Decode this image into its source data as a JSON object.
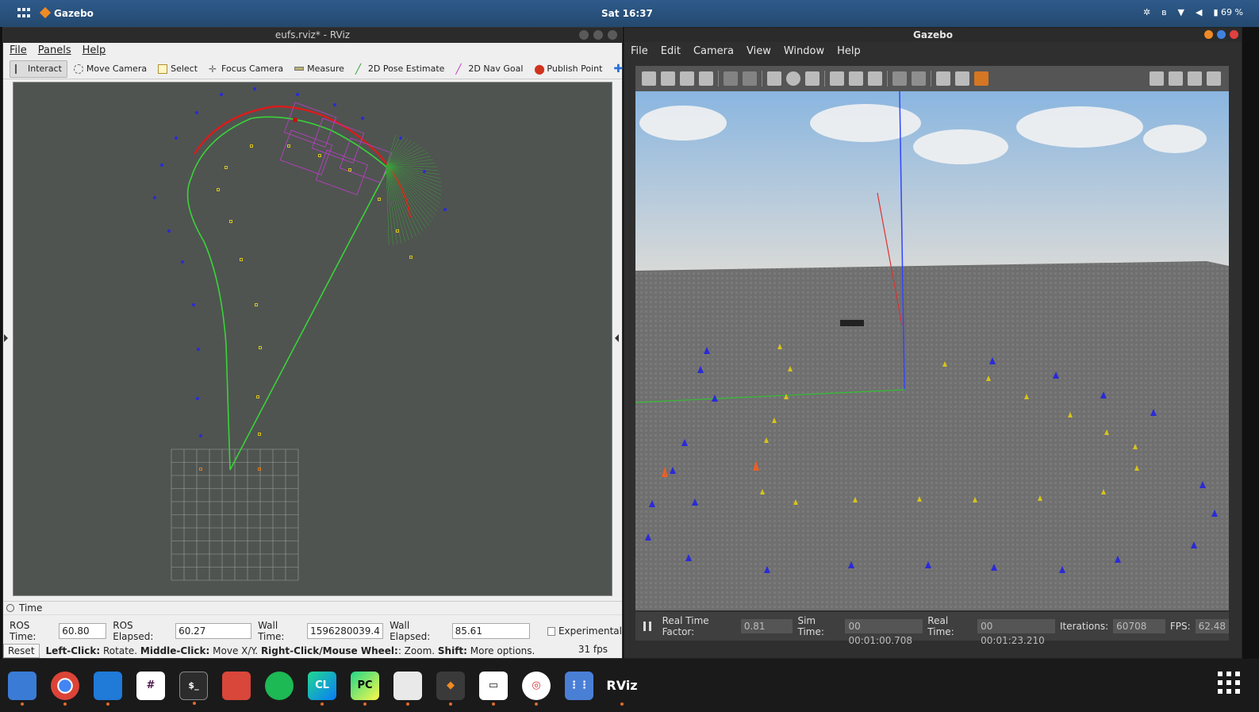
{
  "topbar": {
    "app_name": "Gazebo",
    "clock": "Sat 16:37",
    "battery": "69 %"
  },
  "rviz": {
    "title": "eufs.rviz* - RViz",
    "menu": [
      "File",
      "Panels",
      "Help"
    ],
    "tools": [
      "Interact",
      "Move Camera",
      "Select",
      "Focus Camera",
      "Measure",
      "2D Pose Estimate",
      "2D Nav Goal",
      "Publish Point"
    ],
    "time_panel": {
      "title": "Time",
      "ros_time_label": "ROS Time:",
      "ros_time": "60.80",
      "ros_elapsed_label": "ROS Elapsed:",
      "ros_elapsed": "60.27",
      "wall_time_label": "Wall Time:",
      "wall_time": "1596280039.40",
      "wall_elapsed_label": "Wall Elapsed:",
      "wall_elapsed": "85.61",
      "experimental_label": "Experimental"
    },
    "reset_label": "Reset",
    "help_text": {
      "left_click_key": "Left-Click:",
      "left_click": " Rotate. ",
      "middle_click_key": "Middle-Click:",
      "middle_click": " Move X/Y. ",
      "right_click_key": "Right-Click/Mouse Wheel:",
      "right_click": ": Zoom. ",
      "shift_key": "Shift:",
      "shift": " More options."
    },
    "fps": "31 fps"
  },
  "gazebo": {
    "title": "Gazebo",
    "menu": [
      "File",
      "Edit",
      "Camera",
      "View",
      "Window",
      "Help"
    ],
    "status": {
      "real_time_factor_label": "Real Time Factor:",
      "real_time_factor": "0.81",
      "sim_time_label": "Sim Time:",
      "sim_time": "00 00:01:00.708",
      "real_time_label": "Real Time:",
      "real_time": "00 00:01:23.210",
      "iterations_label": "Iterations:",
      "iterations": "60708",
      "fps_label": "FPS:",
      "fps": "62.48"
    }
  },
  "dock": {
    "items": [
      "files-icon",
      "chrome-icon",
      "vscode-icon",
      "slack-icon",
      "terminal-icon",
      "toolbox-icon",
      "spotify-icon",
      "clion-icon",
      "pycharm-icon",
      "software-icon",
      "gazebo-icon",
      "monitor-icon",
      "help-icon",
      "apps-icon"
    ],
    "rviz_label": "RViz"
  },
  "colors": {
    "blue_cone": "#2a2ad8",
    "yellow_cone": "#d7c41b",
    "path_green": "#39d339",
    "path_red": "#d91c1c",
    "trajectory_magenta": "#c43ccf"
  }
}
